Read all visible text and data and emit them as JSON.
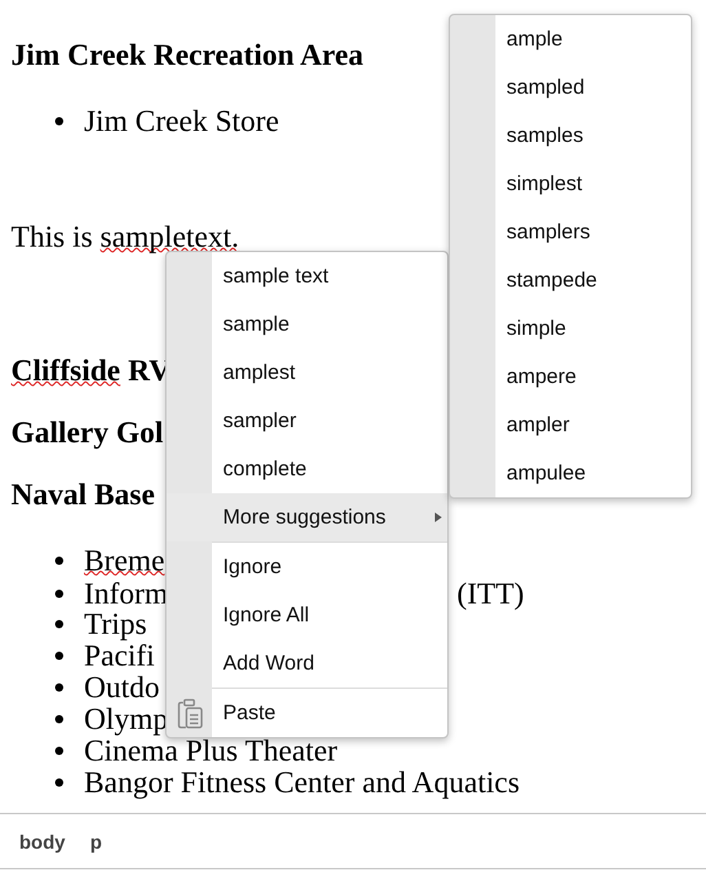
{
  "document": {
    "blocks": [
      {
        "kind": "heading",
        "segments": [
          {
            "text": "Jim Creek Recreation Area",
            "misspelled": false
          }
        ]
      },
      {
        "kind": "list",
        "items": [
          {
            "segments": [
              {
                "text": "Jim Creek Store",
                "misspelled": false
              }
            ]
          }
        ]
      },
      {
        "kind": "paragraph",
        "segments": [
          {
            "text": "This is ",
            "misspelled": false
          },
          {
            "text": "sampletext.",
            "misspelled": true
          }
        ]
      },
      {
        "kind": "heading",
        "segments": [
          {
            "text": "Cliffside",
            "misspelled": true
          },
          {
            "text": " RV",
            "misspelled": false
          }
        ]
      },
      {
        "kind": "heading",
        "segments": [
          {
            "text": "Gallery Gol",
            "misspelled": false
          }
        ]
      },
      {
        "kind": "heading",
        "segments": [
          {
            "text": "Naval Base",
            "misspelled": false
          }
        ]
      },
      {
        "kind": "list",
        "items": [
          {
            "segments": [
              {
                "text": "Breme",
                "misspelled": true
              }
            ]
          },
          {
            "segments": [
              {
                "text": "Inform",
                "misspelled": false
              }
            ],
            "trailing": "(ITT)"
          },
          {
            "segments": [
              {
                "text": "Trips",
                "misspelled": false
              }
            ]
          },
          {
            "segments": [
              {
                "text": "Pacifi",
                "misspelled": false
              }
            ]
          },
          {
            "segments": [
              {
                "text": "Outdo",
                "misspelled": false
              }
            ]
          },
          {
            "segments": [
              {
                "text": "Olymp",
                "misspelled": false
              }
            ]
          },
          {
            "segments": [
              {
                "text": "Cinema Plus Theater",
                "misspelled": false
              }
            ]
          },
          {
            "segments": [
              {
                "text": "Bangor Fitness Center and Aquatics",
                "misspelled": false
              }
            ]
          }
        ]
      }
    ]
  },
  "context_menu": {
    "groups": [
      [
        {
          "label": "sample text",
          "kind": "item",
          "selected": false
        },
        {
          "label": "sample",
          "kind": "item",
          "selected": false
        },
        {
          "label": "amplest",
          "kind": "item",
          "selected": false
        },
        {
          "label": "sampler",
          "kind": "item",
          "selected": false
        },
        {
          "label": "complete",
          "kind": "item",
          "selected": false
        },
        {
          "label": "More suggestions",
          "kind": "submenu",
          "selected": true
        }
      ],
      [
        {
          "label": "Ignore",
          "kind": "item",
          "selected": false
        },
        {
          "label": "Ignore All",
          "kind": "item",
          "selected": false
        },
        {
          "label": "Add Word",
          "kind": "item",
          "selected": false
        }
      ],
      [
        {
          "label": "Paste",
          "kind": "paste",
          "selected": false
        }
      ]
    ]
  },
  "submenu": {
    "groups": [
      [
        {
          "label": "ample",
          "kind": "item",
          "selected": false
        },
        {
          "label": "sampled",
          "kind": "item",
          "selected": false
        },
        {
          "label": "samples",
          "kind": "item",
          "selected": false
        },
        {
          "label": "simplest",
          "kind": "item",
          "selected": false
        },
        {
          "label": "samplers",
          "kind": "item",
          "selected": false
        },
        {
          "label": "stampede",
          "kind": "item",
          "selected": false
        },
        {
          "label": "simple",
          "kind": "item",
          "selected": false
        },
        {
          "label": "ampere",
          "kind": "item",
          "selected": false
        },
        {
          "label": "ampler",
          "kind": "item",
          "selected": false
        },
        {
          "label": "ampulee",
          "kind": "item",
          "selected": false
        }
      ]
    ]
  },
  "status_bar": {
    "path": [
      "body",
      "p"
    ]
  }
}
